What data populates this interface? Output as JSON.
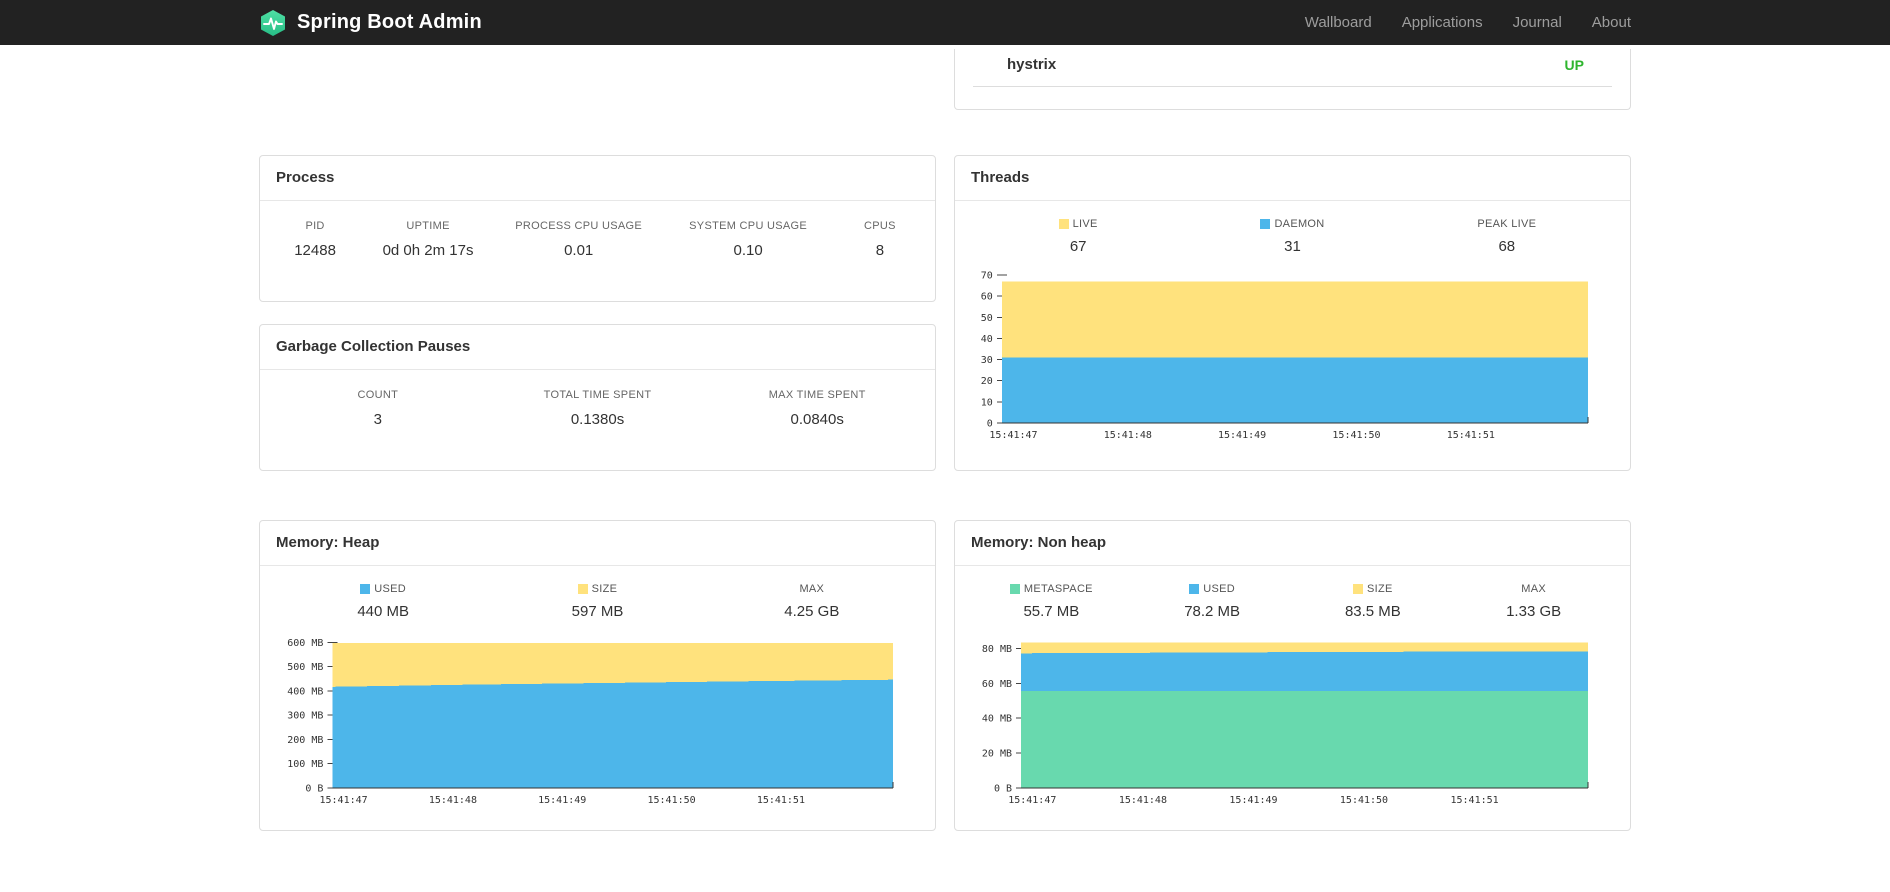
{
  "navbar": {
    "brand": "Spring Boot Admin",
    "logo_icon": "spring-boot-admin-logo",
    "links": [
      {
        "label": "Wallboard"
      },
      {
        "label": "Applications"
      },
      {
        "label": "Journal"
      },
      {
        "label": "About"
      }
    ]
  },
  "health": {
    "rows": [
      {
        "name": "hystrix",
        "status": "UP",
        "status_color": "#2eb52e"
      }
    ]
  },
  "panels": {
    "process": {
      "title": "Process",
      "metrics": [
        {
          "label": "PID",
          "value": "12488"
        },
        {
          "label": "UPTIME",
          "value": "0d 0h 2m 17s"
        },
        {
          "label": "PROCESS CPU USAGE",
          "value": "0.01"
        },
        {
          "label": "SYSTEM CPU USAGE",
          "value": "0.10"
        },
        {
          "label": "CPUS",
          "value": "8"
        }
      ]
    },
    "gc": {
      "title": "Garbage Collection Pauses",
      "metrics": [
        {
          "label": "COUNT",
          "value": "3"
        },
        {
          "label": "TOTAL TIME SPENT",
          "value": "0.1380s"
        },
        {
          "label": "MAX TIME SPENT",
          "value": "0.0840s"
        }
      ]
    },
    "threads": {
      "title": "Threads",
      "legend": [
        {
          "label": "LIVE",
          "value": "67",
          "color": "#ffe27d"
        },
        {
          "label": "DAEMON",
          "value": "31",
          "color": "#4db6ea"
        },
        {
          "label": "PEAK LIVE",
          "value": "68"
        }
      ]
    },
    "heap": {
      "title": "Memory: Heap",
      "legend": [
        {
          "label": "USED",
          "value": "440 MB",
          "color": "#4db6ea"
        },
        {
          "label": "SIZE",
          "value": "597 MB",
          "color": "#ffe27d"
        },
        {
          "label": "MAX",
          "value": "4.25 GB"
        }
      ]
    },
    "nonheap": {
      "title": "Memory: Non heap",
      "legend": [
        {
          "label": "METASPACE",
          "value": "55.7 MB",
          "color": "#68d9ae"
        },
        {
          "label": "USED",
          "value": "78.2 MB",
          "color": "#4db6ea"
        },
        {
          "label": "SIZE",
          "value": "83.5 MB",
          "color": "#ffe27d"
        },
        {
          "label": "MAX",
          "value": "1.33 GB"
        }
      ]
    }
  },
  "chart_data": [
    {
      "id": "threads",
      "type": "area",
      "stacked": true,
      "title": "Threads",
      "x": [
        "15:41:47",
        "15:41:48",
        "15:41:49",
        "15:41:50",
        "15:41:51"
      ],
      "xtick_pos": [
        0.02,
        0.215,
        0.41,
        0.605,
        0.8
      ],
      "ymax": 71,
      "yticks": [
        0,
        10,
        20,
        30,
        40,
        50,
        60,
        70
      ],
      "ytick_labels": [
        "0",
        "10",
        "20",
        "30",
        "40",
        "50",
        "60",
        "70"
      ],
      "series": [
        {
          "name": "DAEMON",
          "color": "#4db6ea",
          "values": [
            31,
            31,
            31,
            31,
            31
          ]
        },
        {
          "name": "LIVE",
          "color": "#ffe27d",
          "values": [
            67,
            67,
            67,
            67,
            67
          ]
        }
      ]
    },
    {
      "id": "heap",
      "type": "area",
      "stacked": false,
      "title": "Memory: Heap",
      "x": [
        "15:41:47",
        "15:41:48",
        "15:41:49",
        "15:41:50",
        "15:41:51"
      ],
      "xtick_pos": [
        0.02,
        0.215,
        0.41,
        0.605,
        0.8
      ],
      "ymax": 618,
      "yticks": [
        0,
        100,
        200,
        300,
        400,
        500,
        600
      ],
      "ytick_labels": [
        "0 B",
        "100 MB",
        "200 MB",
        "300 MB",
        "400 MB",
        "500 MB",
        "600 MB"
      ],
      "series": [
        {
          "name": "USED",
          "color": "#4db6ea",
          "values": [
            417,
            426,
            433,
            440,
            446
          ]
        },
        {
          "name": "SIZE",
          "color": "#ffe27d",
          "values": [
            597,
            597,
            597,
            597,
            597
          ]
        }
      ]
    },
    {
      "id": "nonheap",
      "type": "area",
      "stacked": false,
      "title": "Memory: Non heap",
      "x": [
        "15:41:47",
        "15:41:48",
        "15:41:49",
        "15:41:50",
        "15:41:51"
      ],
      "xtick_pos": [
        0.02,
        0.215,
        0.41,
        0.605,
        0.8
      ],
      "ymax": 86,
      "yticks": [
        0,
        20,
        40,
        60,
        80
      ],
      "ytick_labels": [
        "0 B",
        "20 MB",
        "40 MB",
        "60 MB",
        "80 MB"
      ],
      "series": [
        {
          "name": "METASPACE",
          "color": "#68d9ae",
          "values": [
            55.5,
            55.6,
            55.6,
            55.7,
            55.7
          ]
        },
        {
          "name": "USED",
          "color": "#4db6ea",
          "values": [
            77.2,
            77.6,
            77.9,
            78.2,
            78.4
          ]
        },
        {
          "name": "SIZE",
          "color": "#ffe27d",
          "values": [
            83.5,
            83.5,
            83.5,
            83.5,
            83.5
          ]
        }
      ]
    }
  ]
}
